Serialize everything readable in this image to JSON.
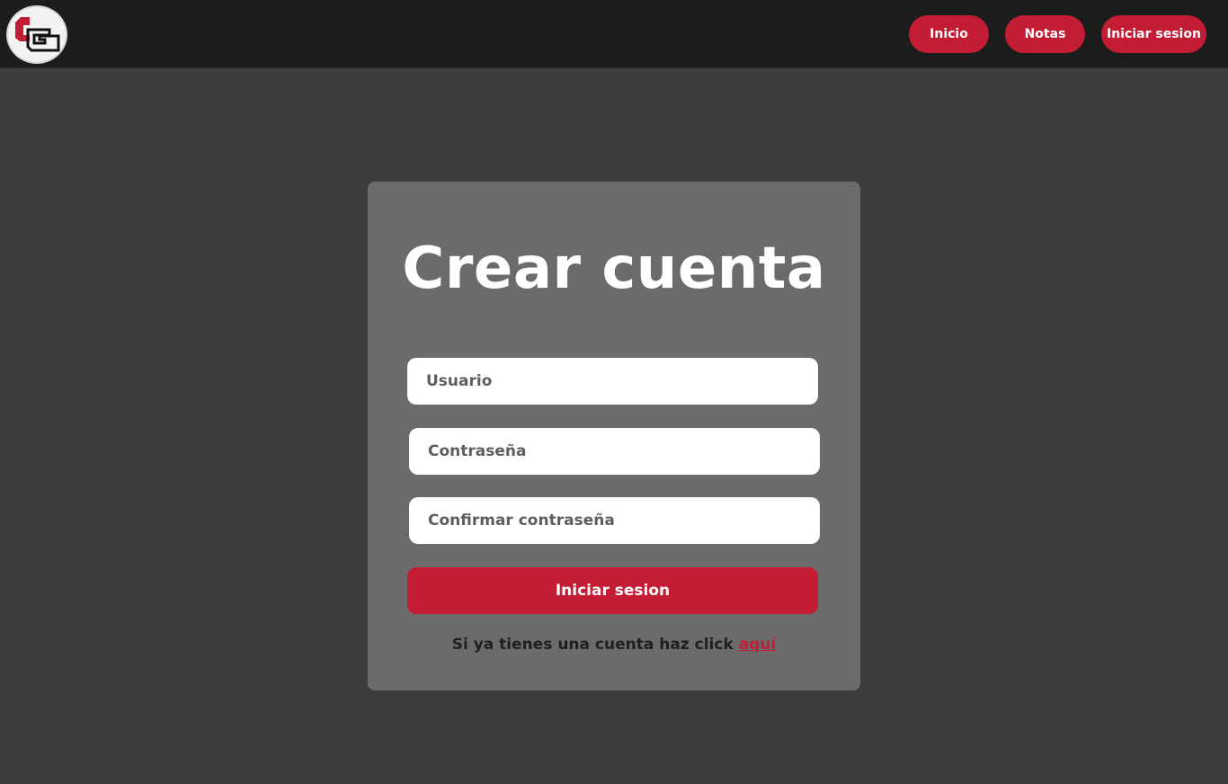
{
  "header": {
    "logo_icon": "cg-logo-icon",
    "nav": {
      "inicio": "Inicio",
      "notas": "Notas",
      "login": "Iniciar sesion"
    }
  },
  "form": {
    "title": "Crear cuenta",
    "user_placeholder": "Usuario",
    "password_placeholder": "Contraseña",
    "confirm_placeholder": "Confirmar contraseña",
    "submit_label": "Iniciar sesion",
    "footer_prefix": "Si ya tienes una cuenta haz click ",
    "footer_link": "aquí"
  },
  "colors": {
    "accent": "#c21d35",
    "header_bg": "#1c1c1c",
    "page_bg": "#3d3d3d",
    "card_bg": "#6b6b6b"
  }
}
